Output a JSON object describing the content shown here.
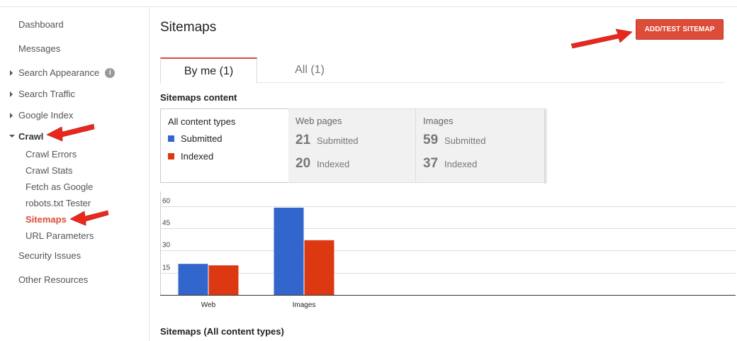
{
  "sidebar": {
    "items": [
      {
        "label": "Dashboard"
      },
      {
        "label": "Messages"
      },
      {
        "label": "Search Appearance"
      },
      {
        "label": "Search Traffic"
      },
      {
        "label": "Google Index"
      },
      {
        "label": "Crawl"
      },
      {
        "label": "Security Issues"
      },
      {
        "label": "Other Resources"
      }
    ],
    "crawl_sub": [
      {
        "label": "Crawl Errors"
      },
      {
        "label": "Crawl Stats"
      },
      {
        "label": "Fetch as Google"
      },
      {
        "label": "robots.txt Tester"
      },
      {
        "label": "Sitemaps"
      },
      {
        "label": "URL Parameters"
      }
    ],
    "info_icon": "i"
  },
  "main": {
    "title": "Sitemaps",
    "add_button": "ADD/TEST SITEMAP",
    "tabs": [
      {
        "label": "By me (1)"
      },
      {
        "label": "All (1)"
      }
    ],
    "content_label": "Sitemaps content",
    "bottom_label": "Sitemaps (All content types)"
  },
  "content_types": {
    "all": {
      "title": "All content types",
      "legend": [
        {
          "label": "Submitted",
          "color": "#3366cc"
        },
        {
          "label": "Indexed",
          "color": "#dc3912"
        }
      ]
    },
    "web": {
      "title": "Web pages",
      "submitted_num": "21",
      "submitted_label": "Submitted",
      "indexed_num": "20",
      "indexed_label": "Indexed"
    },
    "images": {
      "title": "Images",
      "submitted_num": "59",
      "submitted_label": "Submitted",
      "indexed_num": "37",
      "indexed_label": "Indexed"
    }
  },
  "colors": {
    "accent": "#dd4b39",
    "submitted": "#3366cc",
    "indexed": "#dc3912",
    "annotation_arrow": "#e8281f"
  },
  "chart_data": {
    "type": "bar",
    "categories": [
      "Web",
      "Images"
    ],
    "series": [
      {
        "name": "Submitted",
        "values": [
          21,
          59
        ]
      },
      {
        "name": "Indexed",
        "values": [
          20,
          37
        ]
      }
    ],
    "ylim": [
      0,
      70
    ],
    "yticks": [
      15,
      30,
      45,
      60
    ],
    "grid": true
  }
}
